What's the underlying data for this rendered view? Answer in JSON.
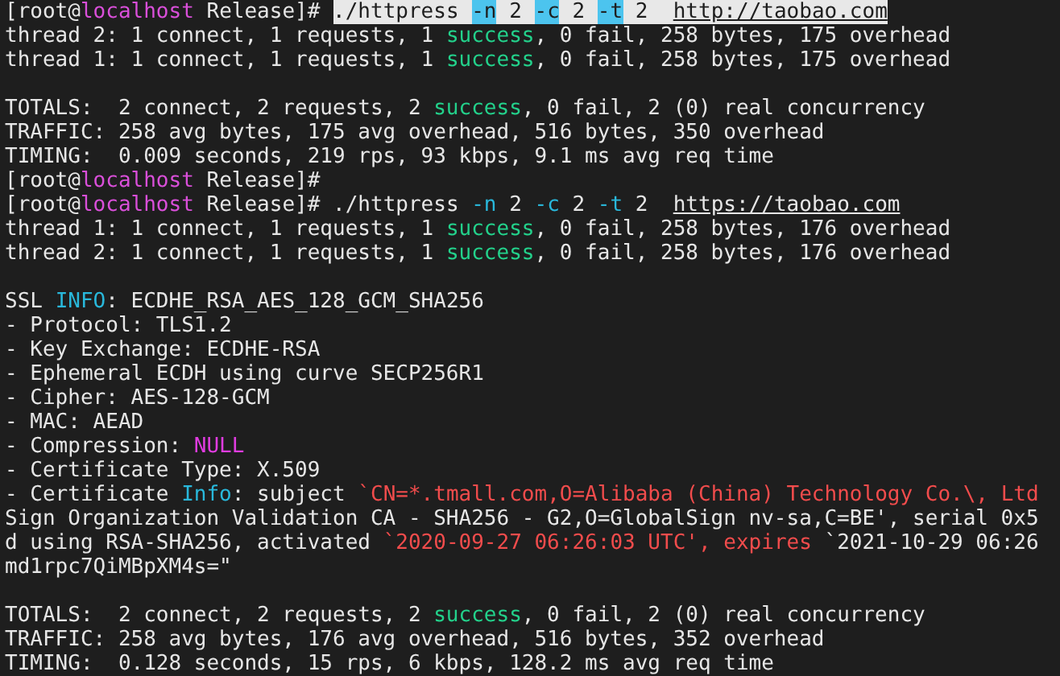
{
  "terminal": {
    "lines": [
      {
        "kind": "text",
        "segments": [
          {
            "text": "[root@",
            "kind": "plain"
          },
          {
            "text": "localhost",
            "kind": "host"
          },
          {
            "text": " Release]# ",
            "kind": "plain"
          },
          {
            "text": "./httpress ",
            "kind": "selected"
          },
          {
            "text": "-n",
            "kind": "selected-flag"
          },
          {
            "text": " 2 ",
            "kind": "selected"
          },
          {
            "text": "-c",
            "kind": "selected-flag"
          },
          {
            "text": " 2 ",
            "kind": "selected"
          },
          {
            "text": "-t",
            "kind": "selected-flag"
          },
          {
            "text": " 2  ",
            "kind": "selected"
          },
          {
            "text": "http://taobao.com",
            "kind": "selected-url"
          }
        ]
      },
      {
        "kind": "text",
        "segments": [
          {
            "text": "thread 2: 1 connect, 1 requests, 1 ",
            "kind": "plain"
          },
          {
            "text": "success",
            "kind": "success"
          },
          {
            "text": ", 0 fail, 258 bytes, 175 overhead",
            "kind": "plain"
          }
        ]
      },
      {
        "kind": "text",
        "segments": [
          {
            "text": "thread 1: 1 connect, 1 requests, 1 ",
            "kind": "plain"
          },
          {
            "text": "success",
            "kind": "success"
          },
          {
            "text": ", 0 fail, 258 bytes, 175 overhead",
            "kind": "plain"
          }
        ]
      },
      {
        "kind": "blank"
      },
      {
        "kind": "text",
        "segments": [
          {
            "text": "TOTALS:  2 connect, 2 requests, 2 ",
            "kind": "plain"
          },
          {
            "text": "success",
            "kind": "success"
          },
          {
            "text": ", 0 fail, 2 (0) real concurrency",
            "kind": "plain"
          }
        ]
      },
      {
        "kind": "text",
        "segments": [
          {
            "text": "TRAFFIC: 258 avg bytes, 175 avg overhead, 516 bytes, 350 overhead",
            "kind": "plain"
          }
        ]
      },
      {
        "kind": "text",
        "segments": [
          {
            "text": "TIMING:  0.009 seconds, 219 rps, 93 kbps, 9.1 ms avg req time",
            "kind": "plain"
          }
        ]
      },
      {
        "kind": "text",
        "segments": [
          {
            "text": "[root@",
            "kind": "plain"
          },
          {
            "text": "localhost",
            "kind": "host"
          },
          {
            "text": " Release]#",
            "kind": "plain"
          }
        ]
      },
      {
        "kind": "text",
        "segments": [
          {
            "text": "[root@",
            "kind": "plain"
          },
          {
            "text": "localhost",
            "kind": "host"
          },
          {
            "text": " Release]# ./httpress ",
            "kind": "plain"
          },
          {
            "text": "-n",
            "kind": "flag"
          },
          {
            "text": " 2 ",
            "kind": "plain"
          },
          {
            "text": "-c",
            "kind": "flag"
          },
          {
            "text": " 2 ",
            "kind": "plain"
          },
          {
            "text": "-t",
            "kind": "flag"
          },
          {
            "text": " 2  ",
            "kind": "plain"
          },
          {
            "text": "https://taobao.com",
            "kind": "url"
          }
        ]
      },
      {
        "kind": "text",
        "segments": [
          {
            "text": "thread 1: 1 connect, 1 requests, 1 ",
            "kind": "plain"
          },
          {
            "text": "success",
            "kind": "success"
          },
          {
            "text": ", 0 fail, 258 bytes, 176 overhead",
            "kind": "plain"
          }
        ]
      },
      {
        "kind": "text",
        "segments": [
          {
            "text": "thread 2: 1 connect, 1 requests, 1 ",
            "kind": "plain"
          },
          {
            "text": "success",
            "kind": "success"
          },
          {
            "text": ", 0 fail, 258 bytes, 176 overhead",
            "kind": "plain"
          }
        ]
      },
      {
        "kind": "blank"
      },
      {
        "kind": "text",
        "segments": [
          {
            "text": "SSL ",
            "kind": "plain"
          },
          {
            "text": "INFO",
            "kind": "info"
          },
          {
            "text": ": ECDHE_RSA_AES_128_GCM_SHA256",
            "kind": "plain"
          }
        ]
      },
      {
        "kind": "text",
        "segments": [
          {
            "text": "- Protocol: TLS1.2",
            "kind": "plain"
          }
        ]
      },
      {
        "kind": "text",
        "segments": [
          {
            "text": "- Key Exchange: ECDHE-RSA",
            "kind": "plain"
          }
        ]
      },
      {
        "kind": "text",
        "segments": [
          {
            "text": "- Ephemeral ECDH using curve SECP256R1",
            "kind": "plain"
          }
        ]
      },
      {
        "kind": "text",
        "segments": [
          {
            "text": "- Cipher: AES-128-GCM",
            "kind": "plain"
          }
        ]
      },
      {
        "kind": "text",
        "segments": [
          {
            "text": "- MAC: AEAD",
            "kind": "plain"
          }
        ]
      },
      {
        "kind": "text",
        "segments": [
          {
            "text": "- Compression: ",
            "kind": "plain"
          },
          {
            "text": "NULL",
            "kind": "null"
          }
        ]
      },
      {
        "kind": "text",
        "segments": [
          {
            "text": "- Certificate Type: X.509",
            "kind": "plain"
          }
        ]
      },
      {
        "kind": "text",
        "segments": [
          {
            "text": "- Certificate ",
            "kind": "plain"
          },
          {
            "text": "Info",
            "kind": "info"
          },
          {
            "text": ": subject ",
            "kind": "plain"
          },
          {
            "text": "`CN=*.tmall.com,O=Alibaba (China) Technology Co.\\, Ltd",
            "kind": "quoted"
          }
        ]
      },
      {
        "kind": "text",
        "segments": [
          {
            "text": "Sign Organization Validation CA - SHA256 - G2,O=GlobalSign nv-sa,C=BE', serial 0x5",
            "kind": "plain"
          }
        ]
      },
      {
        "kind": "text",
        "segments": [
          {
            "text": "d using RSA-SHA256, activated ",
            "kind": "plain"
          },
          {
            "text": "`2020-09-27 06:26:03 UTC', expires ",
            "kind": "quoted"
          },
          {
            "text": "`2021-10-29 06:26",
            "kind": "plain"
          }
        ]
      },
      {
        "kind": "text",
        "segments": [
          {
            "text": "md1rpc7QiMBpXM4s=\"",
            "kind": "plain"
          }
        ]
      },
      {
        "kind": "blank"
      },
      {
        "kind": "text",
        "segments": [
          {
            "text": "TOTALS:  2 connect, 2 requests, 2 ",
            "kind": "plain"
          },
          {
            "text": "success",
            "kind": "success"
          },
          {
            "text": ", 0 fail, 2 (0) real concurrency",
            "kind": "plain"
          }
        ]
      },
      {
        "kind": "text",
        "segments": [
          {
            "text": "TRAFFIC: 258 avg bytes, 176 avg overhead, 516 bytes, 352 overhead",
            "kind": "plain"
          }
        ]
      },
      {
        "kind": "text",
        "segments": [
          {
            "text": "TIMING:  0.128 seconds, 15 rps, 6 kbps, 128.2 ms avg req time",
            "kind": "plain"
          }
        ]
      }
    ]
  }
}
